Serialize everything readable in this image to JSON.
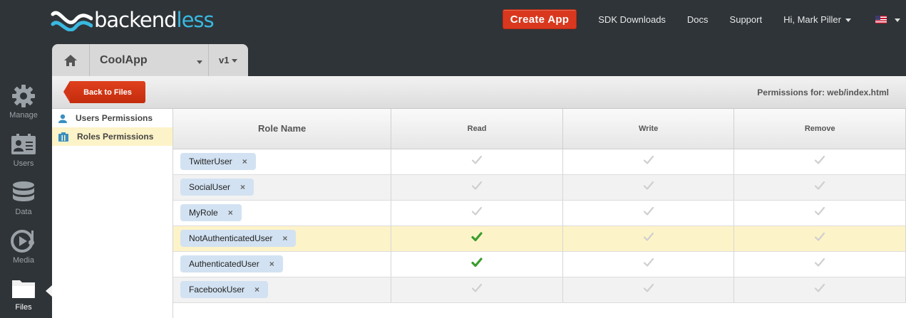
{
  "brand": {
    "name_part1": "backend",
    "name_part2": "less"
  },
  "topnav": {
    "create_app": "Create App",
    "sdk": "SDK Downloads",
    "docs": "Docs",
    "support": "Support",
    "user": "Hi, Mark Piller"
  },
  "sidebar": {
    "items": [
      {
        "label": "Manage",
        "icon": "gear-icon"
      },
      {
        "label": "Users",
        "icon": "users-icon"
      },
      {
        "label": "Data",
        "icon": "database-icon"
      },
      {
        "label": "Media",
        "icon": "media-icon"
      },
      {
        "label": "Files",
        "icon": "folder-icon"
      }
    ],
    "active": "Files"
  },
  "apptabs": {
    "app_name": "CoolApp",
    "version": "v1"
  },
  "panel": {
    "back_label": "Back to Files",
    "permissions_for": "Permissions for: web/index.html"
  },
  "leftnav": {
    "users_permissions": "Users Permissions",
    "roles_permissions": "Roles Permissions",
    "selected": "Roles Permissions"
  },
  "table": {
    "headers": {
      "role": "Role Name",
      "read": "Read",
      "write": "Write",
      "remove": "Remove"
    },
    "rows": [
      {
        "role": "TwitterUser",
        "read": false,
        "write": false,
        "remove": false
      },
      {
        "role": "SocialUser",
        "read": false,
        "write": false,
        "remove": false
      },
      {
        "role": "MyRole",
        "read": false,
        "write": false,
        "remove": false
      },
      {
        "role": "NotAuthenticatedUser",
        "read": true,
        "write": false,
        "remove": false,
        "highlighted": true
      },
      {
        "role": "AuthenticatedUser",
        "read": true,
        "write": false,
        "remove": false
      },
      {
        "role": "FacebookUser",
        "read": false,
        "write": false,
        "remove": false
      }
    ]
  },
  "colors": {
    "granted": "#3a9d2e",
    "inactive": "#cfcfcf",
    "accent": "#39b8e0",
    "create": "#d9381e"
  }
}
